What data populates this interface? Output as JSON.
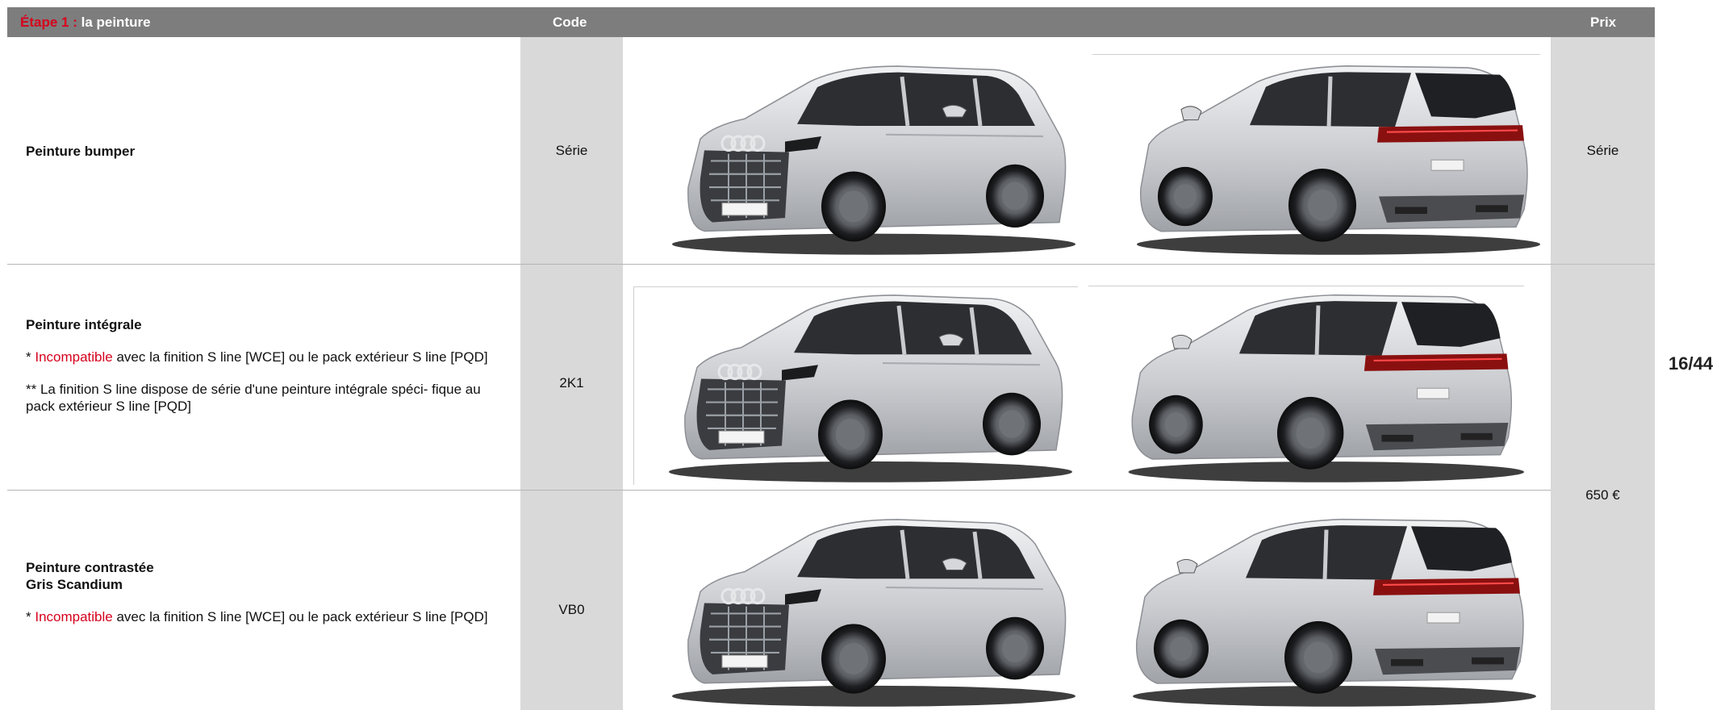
{
  "header": {
    "step_label": "Étape 1 :",
    "step_title": "la peinture",
    "code_label": "Code",
    "price_label": "Prix"
  },
  "rows": [
    {
      "title": "Peinture bumper",
      "code": "Série",
      "price": "Série"
    },
    {
      "title": "Peinture intégrale",
      "note1_prefix": "* ",
      "note1_highlight": "Incompatible",
      "note1_rest": " avec la finition S line [WCE] ou le pack extérieur S line [PQD]",
      "note2": "** La finition S line dispose de série d'une peinture intégrale spéci- fique au pack extérieur S line [PQD]",
      "code": "2K1"
    },
    {
      "title_line1": "Peinture contrastée",
      "title_line2": "Gris Scandium",
      "note1_prefix": "* ",
      "note1_highlight": "Incompatible",
      "note1_rest": " avec la finition S line [WCE] ou le pack extérieur S line [PQD]",
      "code": "VB0"
    }
  ],
  "shared_price": "650 €",
  "page_number": "16/44",
  "colors": {
    "accent_red": "#d6001c",
    "header_grey": "#7d7d7d",
    "column_grey": "#d9d9d9"
  }
}
